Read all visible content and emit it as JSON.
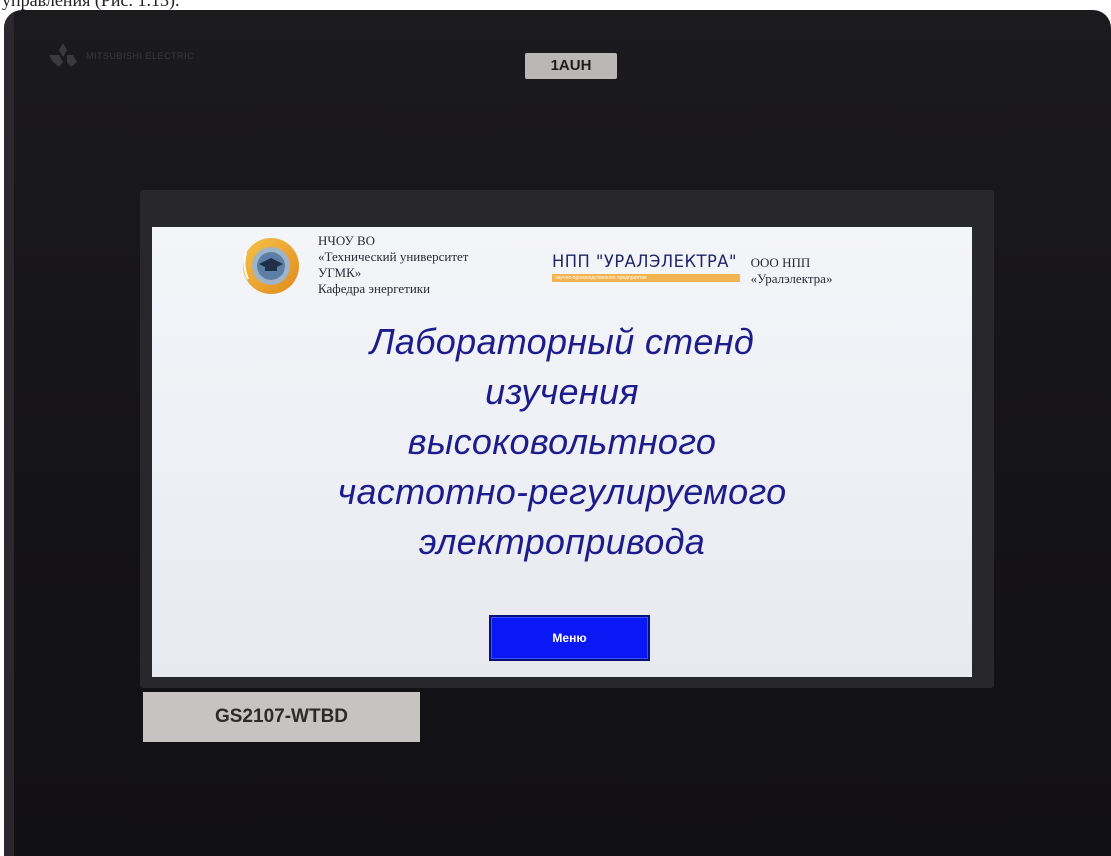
{
  "caption": {
    "text": "управления (Рис. 1.13)."
  },
  "device": {
    "brand_label": "MITSUBISHI ELECTRIC",
    "model_tag": "1AUH",
    "product_tag": "GS2107-WTBD"
  },
  "screen": {
    "org_left": {
      "lines": [
        "НЧОУ ВО",
        "«Технический университет",
        "УГМК»",
        "Кафедра энергетики"
      ]
    },
    "org_right": {
      "logo_text": "НПП \"УРАЛЭЛЕКТРА\"",
      "strip_text": "научно-производственное предприятие",
      "lines": [
        "ООО НПП",
        "«Уралэлектра»"
      ]
    },
    "title_lines": [
      "Лабораторный стенд",
      "изучения",
      "высоковольтного",
      "частотно-регулируемого",
      "электропривода"
    ],
    "menu_button_label": "Меню"
  },
  "colors": {
    "title": "#1c1c8c",
    "menu_button": "#0a18f5",
    "bezel": "#141316",
    "npp_strip": "#f2b350"
  }
}
